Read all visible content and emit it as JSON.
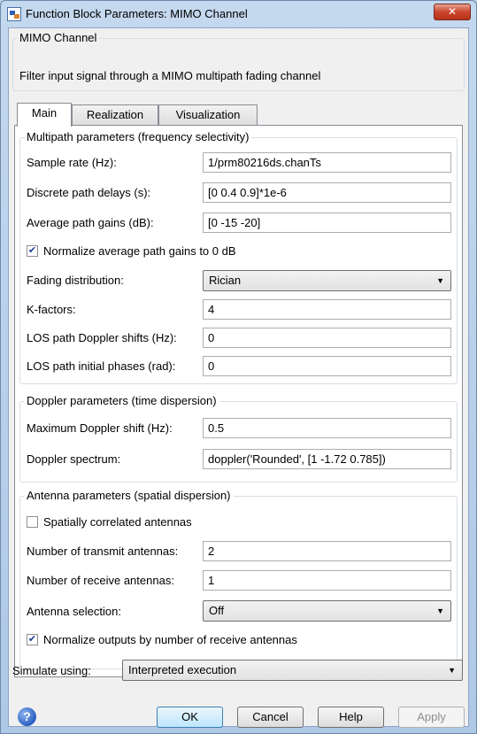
{
  "window": {
    "title": "Function Block Parameters: MIMO Channel",
    "close_glyph": "✕"
  },
  "block": {
    "name": "MIMO Channel",
    "description": "Filter input signal through a MIMO multipath fading channel"
  },
  "tabs": [
    {
      "label": "Main",
      "active": true
    },
    {
      "label": "Realization",
      "active": false
    },
    {
      "label": "Visualization",
      "active": false
    }
  ],
  "multipath": {
    "legend": "Multipath parameters (frequency selectivity)",
    "sample_rate": {
      "label": "Sample rate (Hz):",
      "value": "1/prm80216ds.chanTs"
    },
    "path_delays": {
      "label": "Discrete path delays (s):",
      "value": "[0 0.4 0.9]*1e-6"
    },
    "path_gains": {
      "label": "Average path gains (dB):",
      "value": "[0 -15 -20]"
    },
    "normalize": {
      "label": "Normalize average path gains to 0 dB",
      "checked": true
    },
    "fading": {
      "label": "Fading distribution:",
      "value": "Rician"
    },
    "kfactors": {
      "label": "K-factors:",
      "value": "4"
    },
    "los_doppler": {
      "label": "LOS path Doppler shifts (Hz):",
      "value": "0"
    },
    "los_phase": {
      "label": "LOS path initial phases (rad):",
      "value": "0"
    }
  },
  "doppler": {
    "legend": "Doppler parameters (time dispersion)",
    "max_shift": {
      "label": "Maximum Doppler shift (Hz):",
      "value": "0.5"
    },
    "spectrum": {
      "label": "Doppler spectrum:",
      "value": "doppler('Rounded', [1 -1.72 0.785])"
    }
  },
  "antenna": {
    "legend": "Antenna parameters (spatial dispersion)",
    "spatial": {
      "label": "Spatially correlated antennas",
      "checked": false
    },
    "tx": {
      "label": "Number of transmit antennas:",
      "value": "2"
    },
    "rx": {
      "label": "Number of receive antennas:",
      "value": "1"
    },
    "selection": {
      "label": "Antenna selection:",
      "value": "Off"
    },
    "normalize_outputs": {
      "label": "Normalize outputs by number of receive antennas",
      "checked": true
    }
  },
  "simulate": {
    "label": "Simulate using:",
    "value": "Interpreted execution"
  },
  "buttons": {
    "ok": "OK",
    "cancel": "Cancel",
    "help": "Help",
    "apply": "Apply"
  },
  "help_icon": {
    "glyph": "?",
    "icon": "help-icon"
  },
  "glyphs": {
    "check": "✔",
    "dropdown": "▼"
  }
}
